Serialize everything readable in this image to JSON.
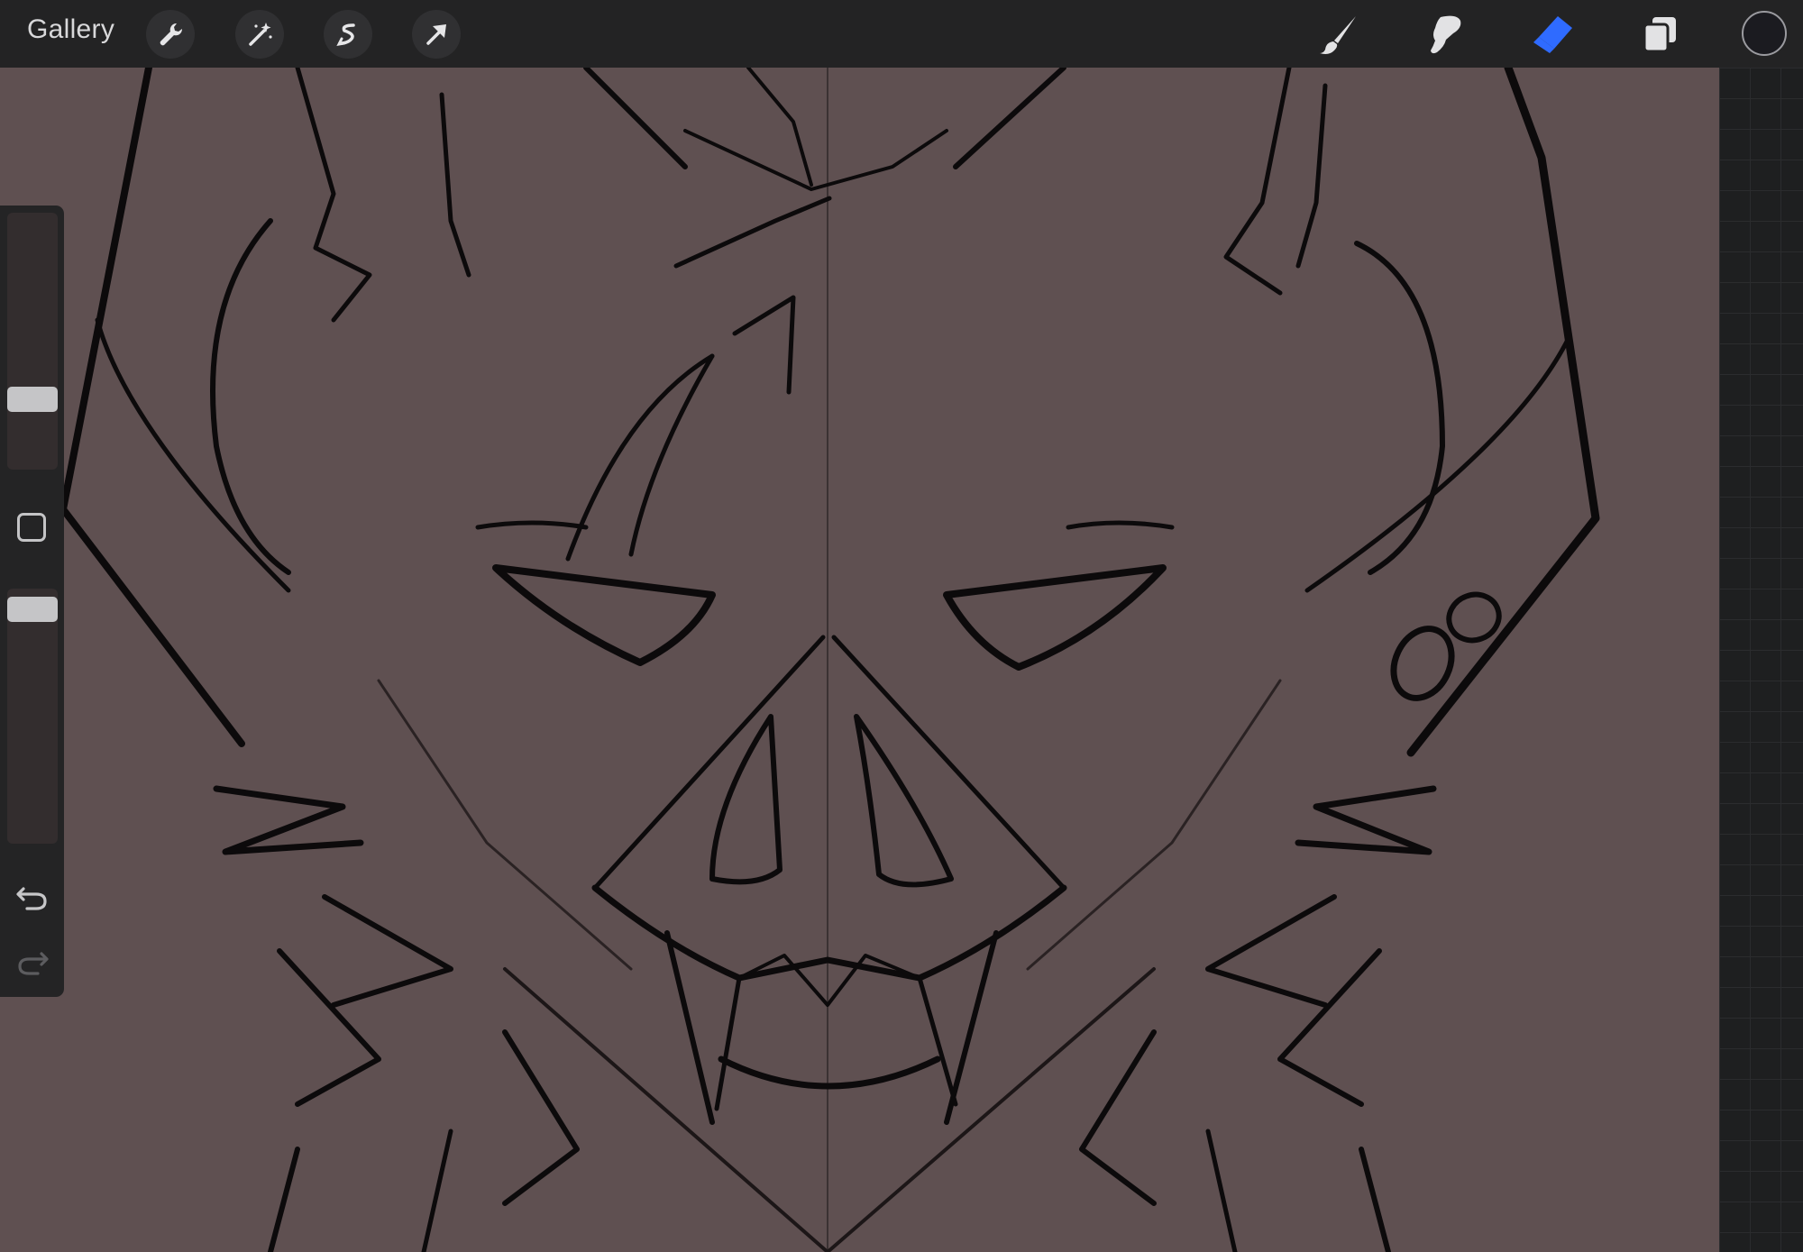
{
  "toolbar": {
    "gallery_label": "Gallery",
    "left_tools": [
      "wrench-icon",
      "magic-wand-icon",
      "selection-icon",
      "arrow-icon"
    ],
    "right_tools": [
      "brush-icon",
      "smudge-icon",
      "eraser-icon",
      "layers-icon"
    ],
    "active_tool": "eraser",
    "active_color": "#1b1b20",
    "accent": "#2f6bff"
  },
  "sidebar": {
    "brush_size": 0.31,
    "brush_opacity": 0.95,
    "controls": [
      "brush-size-slider",
      "modify-button",
      "opacity-slider",
      "undo-button",
      "redo-button"
    ]
  },
  "canvas": {
    "background_color": "#5f5051",
    "line_color": "#0c0a0b",
    "symmetry_guide": "vertical"
  }
}
